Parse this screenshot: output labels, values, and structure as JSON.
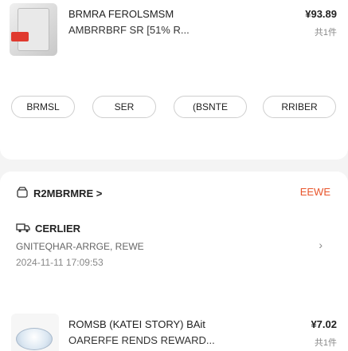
{
  "order1": {
    "title_line1": "BRMRA FEROLSMSM",
    "title_line2": "AMBRRBRF SR [51% R...",
    "price": "¥93.89",
    "qty": "共1件"
  },
  "actions": [
    "BRMSL",
    "SER",
    "(BSNTE",
    "RRIBER"
  ],
  "shop": {
    "name": "R2MBRMRE >",
    "status": "EEWE"
  },
  "logistics": {
    "title": "CERLIER",
    "desc": "GNITEQHAR-ARRGE, REWE",
    "time": "2024-11-11 17:09:53"
  },
  "order2": {
    "title_line1": "ROMSB (KATEI STORY) BAit",
    "title_line2": "OARERFE RENDS REWARD...",
    "price": "¥7.02",
    "qty": "共1件"
  },
  "colors": {
    "accent": "#e8552c"
  }
}
